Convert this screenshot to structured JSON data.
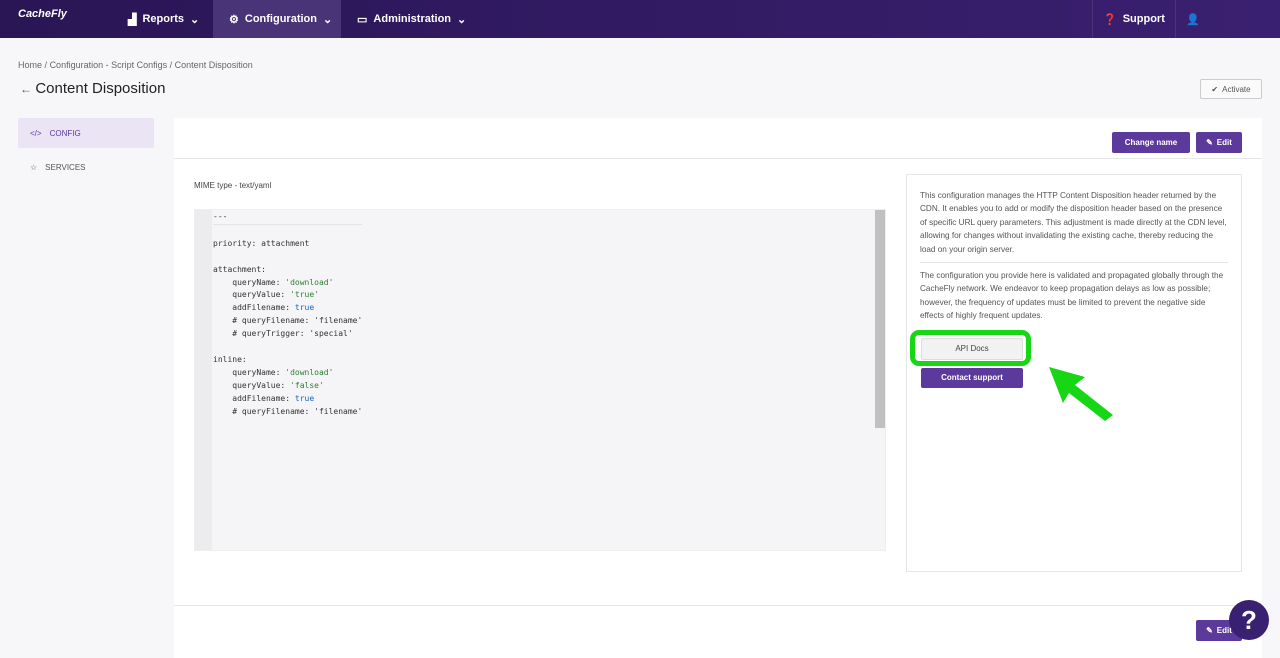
{
  "nav": {
    "logo": "CacheFly",
    "items": [
      {
        "label": "Reports"
      },
      {
        "label": "Configuration"
      },
      {
        "label": "Administration"
      }
    ],
    "support": "Support"
  },
  "breadcrumb": [
    "Home",
    "/",
    "Configuration - Script Configs",
    "/",
    "Content Disposition"
  ],
  "title": "Content Disposition",
  "activate": "Activate",
  "sidebar": [
    {
      "label": "CONFIG"
    },
    {
      "label": "SERVICES"
    }
  ],
  "toolbar": {
    "change_name": "Change name",
    "edit": "Edit"
  },
  "mime": "MIME type - text/yaml",
  "code": [
    "---",
    "",
    "priority: attachment",
    "",
    "attachment:",
    "    queryName: 'download'",
    "    queryValue: 'true'",
    "    addFilename: true",
    "    # queryFilename: 'filename'",
    "    # queryTrigger: 'special'",
    "",
    "inline:",
    "    queryName: 'download'",
    "    queryValue: 'false'",
    "    addFilename: true",
    "    # queryFilename: 'filename'"
  ],
  "info": {
    "p1": "This configuration manages the HTTP Content Disposition header returned by the CDN. It enables you to add or modify the disposition header based on the presence of specific URL query parameters. This adjustment is made directly at the CDN level, allowing for changes without invalidating the existing cache, thereby reducing the load on your origin server.",
    "p2": "The configuration you provide here is validated and propagated globally through the CacheFly network. We endeavor to keep propagation delays as low as possible; however, the frequency of updates must be limited to prevent the negative side effects of highly frequent updates.",
    "api_docs": "API Docs",
    "contact": "Contact support"
  },
  "help": "?",
  "colors": {
    "accent": "#5b3a9c",
    "nav": "#2a1555",
    "highlight": "#16d616"
  }
}
